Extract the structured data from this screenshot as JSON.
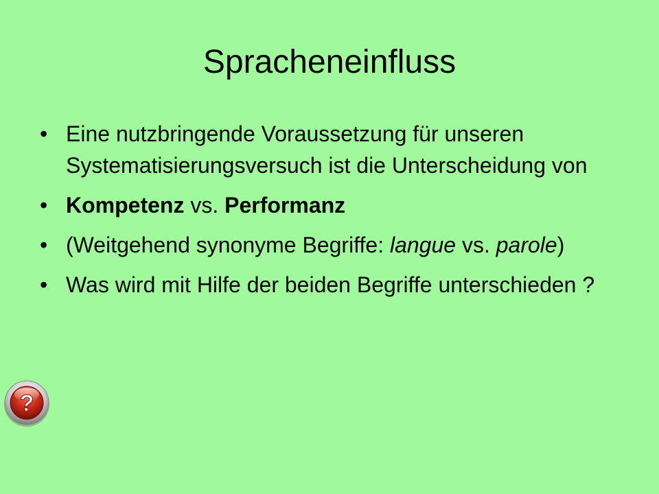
{
  "slide": {
    "title": "Spracheneinfluss",
    "bullets": [
      {
        "dot": "•",
        "text": "Eine nutzbringende Voraussetzung für unseren Systematisierungsversuch ist die Unterscheidung von"
      },
      {
        "dot": "•",
        "bold1": "Kompetenz",
        "mid": " vs. ",
        "bold2": "Performanz"
      },
      {
        "dot": "•",
        "pre": "(Weitgehend synonyme Begriffe: ",
        "italic1": "langue",
        "mid": " vs. ",
        "italic2": "parole",
        "post": ")"
      },
      {
        "dot": "•",
        "text": "Was wird mit Hilfe der beiden Begriffe unterschieden ?"
      }
    ]
  },
  "help_button": {
    "icon": "question-mark-icon",
    "glyph": "?",
    "colors": {
      "ring": "#d8d8d8",
      "inner": "#c62a1a",
      "glyph": "#ffffff"
    }
  },
  "colors": {
    "background": "#a0fa9c",
    "text": "#000000"
  }
}
